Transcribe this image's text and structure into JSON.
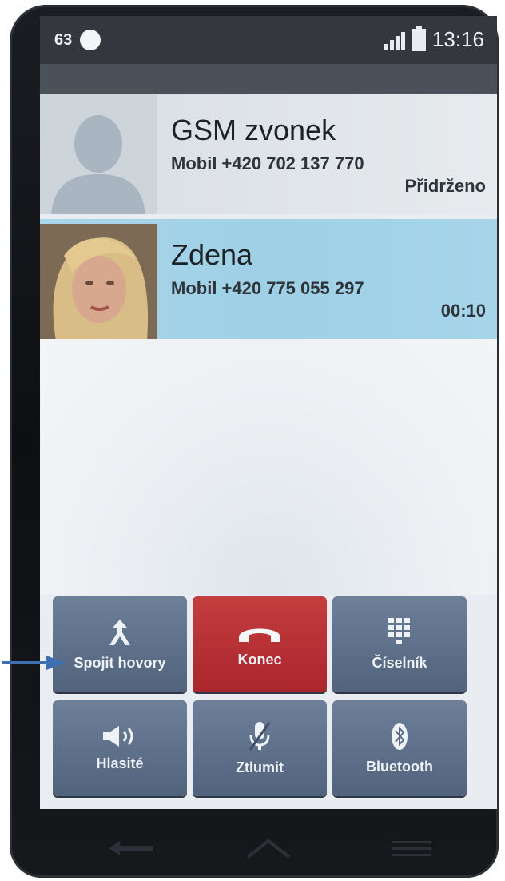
{
  "status_bar": {
    "notification_count": "63",
    "time": "13:16"
  },
  "calls": [
    {
      "name": "GSM zvonek",
      "number": "Mobil +420 702 137 770",
      "status": "Přidrženo"
    },
    {
      "name": "Zdena",
      "number": "Mobil +420 775 055 297",
      "status": "00:10"
    }
  ],
  "controls": {
    "merge": "Spojit hovory",
    "end": "Konec",
    "dialpad": "Číselník",
    "speaker": "Hlasité",
    "mute": "Ztlumit",
    "bluetooth": "Bluetooth"
  },
  "colors": {
    "active_call": "#a6d5ea",
    "end_button": "#b32d31",
    "control_button": "#5f708a",
    "annotation_arrow": "#3f6fb3"
  },
  "icons": {
    "merge": "merge-calls-icon",
    "end": "hang-up-icon",
    "dialpad": "dialpad-icon",
    "speaker": "speaker-icon",
    "mute": "microphone-muted-icon",
    "bluetooth": "bluetooth-icon"
  }
}
